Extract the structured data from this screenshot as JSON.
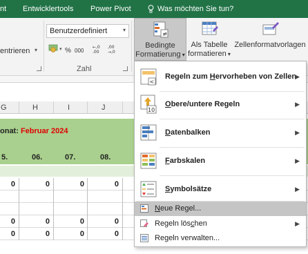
{
  "tabs": [
    "nt",
    "Entwicklertools",
    "Power Pivot"
  ],
  "tell_me": "Was möchten Sie tun?",
  "ribbon": {
    "number_format": "Benutzerdefiniert",
    "align_label": "entrieren",
    "number_group_label": "Zahl",
    "percent_symbol": "%",
    "thousand_symbol": "000",
    "cond_format_label_1": "Bedingte",
    "cond_format_label_2": "Formatierung",
    "as_table_label_1": "Als Tabelle",
    "as_table_label_2": "formatieren",
    "cell_styles_label": "Zellenformatvorlagen"
  },
  "grid": {
    "columns": [
      "G",
      "H",
      "I",
      "J"
    ],
    "month_label": "onat:",
    "month_value": "Februar 2024",
    "day_headers": [
      "5.",
      "06.",
      "07.",
      "08."
    ],
    "row1": [
      "0",
      "0",
      "0",
      "0"
    ],
    "row2": [
      "0",
      "0",
      "0",
      "0"
    ],
    "row3": [
      "0",
      "0",
      "0",
      "0"
    ]
  },
  "menu": {
    "item1_pre": "Regeln zum ",
    "item1_u": "H",
    "item1_post": "ervorheben von Zellen",
    "item2_u": "O",
    "item2_post": "bere/untere Regeln",
    "item3_u": "D",
    "item3_post": "atenbalken",
    "item4_u": "F",
    "item4_post": "arbskalen",
    "item5_u": "S",
    "item5_post": "ymbolsätze",
    "item6_u": "N",
    "item6_post": "eue Regel...",
    "item7_pre": "Regeln lös",
    "item7_u": "c",
    "item7_post": "hen",
    "item8_pre": "Re",
    "item8_u": "g",
    "item8_post": "eln verwalten...",
    "top10_label": "10"
  },
  "colors": {
    "excel_green": "#217346",
    "band_green": "#a9d08e",
    "highlight": "#c5c5c5",
    "month_red": "#e00000"
  }
}
